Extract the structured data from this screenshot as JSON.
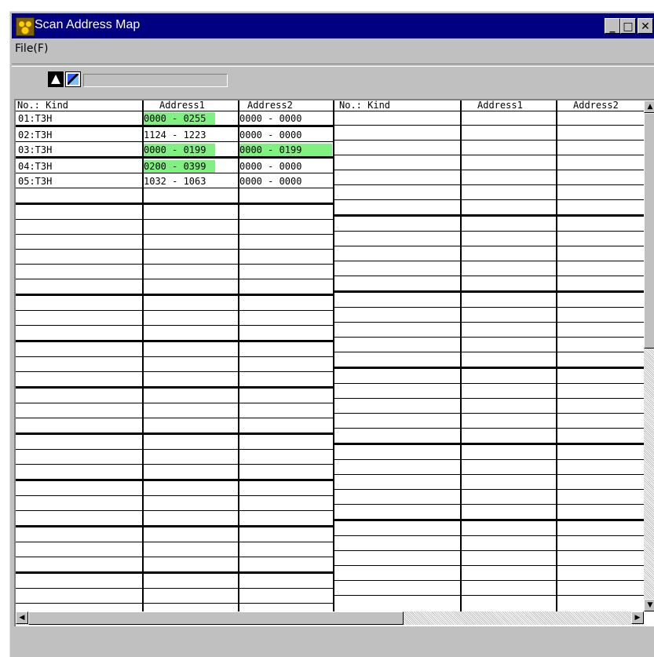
{
  "window": {
    "title": "Scan Address Map",
    "buttons": {
      "minimize": "_",
      "maximize": "□",
      "close": "✕"
    }
  },
  "menu": {
    "file": "File(F)"
  },
  "toolbar": {
    "icons": [
      "run-icon",
      "map-icon"
    ],
    "status_text": ""
  },
  "left_panel": {
    "headers": [
      "No.: Kind",
      "Address1",
      "Address2"
    ],
    "rows": [
      {
        "kind": "01:T3H",
        "addr1": "0000 - 0255",
        "addr2": "0000 - 0000",
        "addr1_highlight": true,
        "addr2_highlight": false
      },
      {
        "kind": "02:T3H",
        "addr1": "1124 - 1223",
        "addr2": "0000 - 0000",
        "addr1_highlight": false,
        "addr2_highlight": false
      },
      {
        "kind": "03:T3H",
        "addr1": "0000 - 0199",
        "addr2": "0000 - 0199",
        "addr1_highlight": true,
        "addr2_highlight": true
      },
      {
        "kind": "04:T3H",
        "addr1": "0200 - 0399",
        "addr2": "0000 - 0000",
        "addr1_highlight": true,
        "addr2_highlight": false
      },
      {
        "kind": "05:T3H",
        "addr1": "1032 - 1063",
        "addr2": "0000 - 0000",
        "addr1_highlight": false,
        "addr2_highlight": false
      }
    ],
    "empty_rows": 27
  },
  "right_panel": {
    "headers": [
      "No.: Kind",
      "Address1",
      "Address2"
    ],
    "empty_rows": 32
  },
  "colors": {
    "highlight": "#80f080",
    "titlebar": "#000080",
    "face": "#c0c0c0"
  }
}
